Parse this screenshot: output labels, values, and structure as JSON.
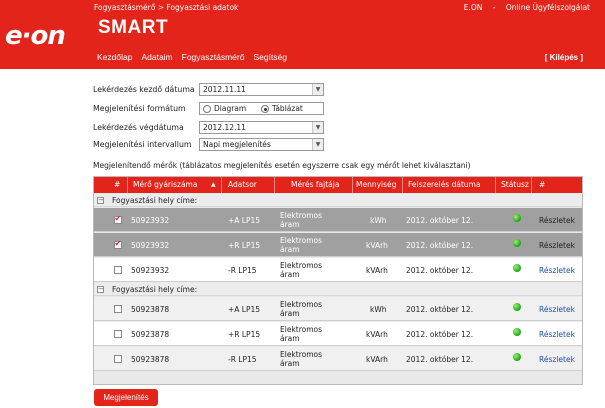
{
  "header": {
    "breadcrumb": [
      "Fogyasztásmérő",
      ">",
      "Fogyasztási adatok"
    ],
    "brand_link": "E.ON",
    "separator": "-",
    "service_link": "Online Ügyfélszolgálat",
    "logo_text": "e·on",
    "app_title": "SMART",
    "nav": [
      "Kezdőlap",
      "Adataim",
      "Fogyasztásmérő",
      "Segítség"
    ],
    "logout": "[ Kilépés ]"
  },
  "form": {
    "start_date_label": "Lekérdezés kezdő dátuma",
    "start_date_value": "2012.11.11",
    "format_label": "Megjelenítési formátum",
    "format_options": [
      "Diagram",
      "Táblázat"
    ],
    "format_selected": "Táblázat",
    "end_date_label": "Lekérdezés végdátuma",
    "end_date_value": "2012.12.11",
    "interval_label": "Megjelenítési intervallum",
    "interval_value": "Napi megjelenítés"
  },
  "meters_note": "Megjelenítendő mérők (táblázatos megjelenítés esetén egyszerre csak egy mérőt lehet kiválasztani)",
  "table": {
    "columns": [
      "#",
      "Mérő gyáriszáma",
      "▲",
      "Adatsor",
      "Mérés fajtája",
      "Mennyiség",
      "Felszerelés dátuma",
      "Státusz",
      "#"
    ],
    "groups": [
      {
        "label": "Fogyasztási hely címe:",
        "expander": "⊟",
        "rows": [
          {
            "checked": true,
            "selected": true,
            "serial": "50923932",
            "series": "+A LP15",
            "type": "Elektromos áram",
            "unit": "kWh",
            "date": "2012. október 12.",
            "status": "ok",
            "action": "Részletek"
          },
          {
            "checked": true,
            "selected": true,
            "serial": "50923932",
            "series": "+R LP15",
            "type": "Elektromos áram",
            "unit": "kVArh",
            "date": "2012. október 12.",
            "status": "ok",
            "action": "Részletek"
          },
          {
            "checked": false,
            "selected": false,
            "serial": "50923932",
            "series": "-R LP15",
            "type": "Elektromos áram",
            "unit": "kVArh",
            "date": "2012. október 12.",
            "status": "ok",
            "action": "Részletek"
          }
        ]
      },
      {
        "label": "Fogyasztási hely címe:",
        "expander": "⊟",
        "rows": [
          {
            "checked": false,
            "selected": false,
            "serial": "50923878",
            "series": "+A LP15",
            "type": "Elektromos áram",
            "unit": "kWh",
            "date": "2012. október 12.",
            "status": "ok",
            "action": "Részletek"
          },
          {
            "checked": false,
            "selected": false,
            "serial": "50923878",
            "series": "+R LP15",
            "type": "Elektromos áram",
            "unit": "kVArh",
            "date": "2012. október 12.",
            "status": "ok",
            "action": "Részletek"
          },
          {
            "checked": false,
            "selected": false,
            "serial": "50923878",
            "series": "-R LP15",
            "type": "Elektromos áram",
            "unit": "kVArh",
            "date": "2012. október 12.",
            "status": "ok",
            "action": "Részletek"
          }
        ]
      }
    ]
  },
  "submit_label": "Megjelenítés",
  "colors": {
    "brand_red": "#e3241b",
    "selected_row": "#a0a0a0",
    "status_ok": "#2bbf2b",
    "link": "#1f4fa8"
  }
}
